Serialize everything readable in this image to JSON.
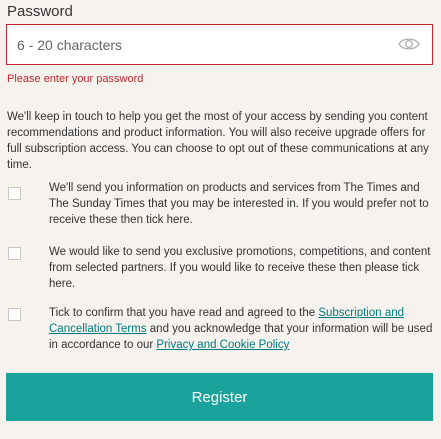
{
  "password": {
    "label": "Password",
    "placeholder": "6 - 20 characters",
    "value": "",
    "toggle_icon": "eye-icon",
    "error": "Please enter your password"
  },
  "intro": "We'll keep in touch to help you get the most of your access by sending you content recommendations and product information. You will also receive upgrade offers for full subscription access. You can choose to opt out of these communications at any time.",
  "options": [
    {
      "checked": false,
      "text": "We'll send you information on products and services from The Times and The Sunday Times that you may be interested in. If you would prefer not to receive these then tick here."
    },
    {
      "checked": false,
      "text": "We would like to send you exclusive promotions, competitions, and content from selected partners. If you would like to receive these then please tick here."
    },
    {
      "checked": false,
      "text_before": "Tick to confirm that you have read and agreed to the ",
      "link1": "Subscription and Cancellation Terms",
      "text_middle": " and you acknowledge that your information will be used in accordance to our ",
      "link2": "Privacy and Cookie Policy"
    }
  ],
  "register_label": "Register",
  "colors": {
    "accent": "#1aa39d",
    "error": "#c4262e",
    "link": "#007a80",
    "background": "#f6f3ee"
  }
}
